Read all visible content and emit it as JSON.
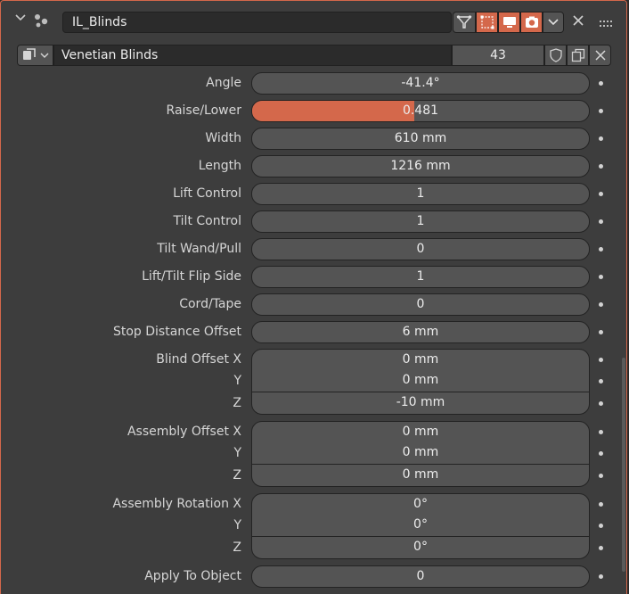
{
  "header": {
    "name": "IL_Blinds",
    "icons": [
      "chevron-down-icon",
      "node-group-icon",
      "filter-icon",
      "select-icon",
      "viewport-icon",
      "render-camera-icon",
      "chevron-down-icon",
      "close-icon",
      "drag-handle-icon"
    ]
  },
  "datablock": {
    "name": "Venetian Blinds",
    "users": "43",
    "icons": [
      "datablock-type-icon",
      "fake-user-shield-icon",
      "duplicate-icon",
      "unlink-icon"
    ]
  },
  "properties": [
    {
      "label": "Angle",
      "value": "-41.4°"
    },
    {
      "label": "Raise/Lower",
      "value": "0.481",
      "fill": 0.481
    },
    {
      "label": "Width",
      "value": "610 mm"
    },
    {
      "label": "Length",
      "value": "1216 mm"
    },
    {
      "label": "Lift Control",
      "value": "1"
    },
    {
      "label": "Tilt Control",
      "value": "1"
    },
    {
      "label": "Tilt Wand/Pull",
      "value": "0"
    },
    {
      "label": "Lift/Tilt Flip Side",
      "value": "1"
    },
    {
      "label": "Cord/Tape",
      "value": "0"
    },
    {
      "label": "Stop Distance Offset",
      "value": "6 mm"
    },
    {
      "label": "Blind Offset X",
      "value": "0 mm"
    },
    {
      "label": "Y",
      "value": "0 mm"
    },
    {
      "label": "Z",
      "value": "-10 mm"
    },
    {
      "label": "Assembly Offset X",
      "value": "0 mm"
    },
    {
      "label": "Y",
      "value": "0 mm"
    },
    {
      "label": "Z",
      "value": "0 mm"
    },
    {
      "label": "Assembly Rotation X",
      "value": "0°"
    },
    {
      "label": "Y",
      "value": "0°"
    },
    {
      "label": "Z",
      "value": "0°"
    },
    {
      "label": "Apply To Object",
      "value": "0"
    }
  ],
  "colors": {
    "accent": "#d4684b",
    "panel": "#3d3d3d",
    "field": "#545454"
  }
}
